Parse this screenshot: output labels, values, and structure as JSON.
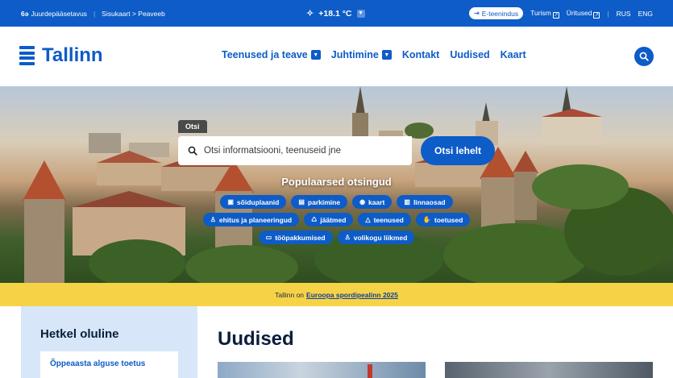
{
  "topbar": {
    "accessibility": "Juurdepääsetavus",
    "breadcrumb": "Sisukaart > Peaveeb",
    "weather": "+18.1 °C",
    "eservices": "E-teenindus",
    "tourism": "Turism",
    "events": "Üritused",
    "lang_rus": "RUS",
    "lang_eng": "ENG"
  },
  "header": {
    "logo": "Tallinn",
    "nav": [
      {
        "label": "Teenused ja teave"
      },
      {
        "label": "Juhtimine"
      },
      {
        "label": "Kontakt"
      },
      {
        "label": "Uudised"
      },
      {
        "label": "Kaart"
      }
    ]
  },
  "hero": {
    "search_tab": "Otsi",
    "search_placeholder": "Otsi informatsiooni, teenuseid jne",
    "search_button": "Otsi lehelt",
    "popular_title": "Populaarsed otsingud",
    "chips": [
      {
        "label": "sõiduplaanid",
        "icon": "bus-icon"
      },
      {
        "label": "parkimine",
        "icon": "parking-icon"
      },
      {
        "label": "kaart",
        "icon": "location-pin-icon"
      },
      {
        "label": "linnaosad",
        "icon": "city-icon"
      },
      {
        "label": "ehitus ja planeeringud",
        "icon": "worker-icon"
      },
      {
        "label": "jäätmed",
        "icon": "recycle-icon"
      },
      {
        "label": "teenused",
        "icon": "triangle-icon"
      },
      {
        "label": "toetused",
        "icon": "support-hand-icon"
      },
      {
        "label": "tööpakkumised",
        "icon": "briefcase-icon"
      },
      {
        "label": "volikogu liikmed",
        "icon": "person-icon"
      }
    ]
  },
  "banner": {
    "prefix": "Tallinn on",
    "link": "Euroopa spordipealinn 2025"
  },
  "important": {
    "title": "Hetkel oluline",
    "card": "Õppeaasta alguse toetus"
  },
  "news": {
    "title": "Uudised"
  },
  "colors": {
    "primary": "#0d5cc7",
    "banner": "#f6d247",
    "panel": "#d7e7f9"
  }
}
